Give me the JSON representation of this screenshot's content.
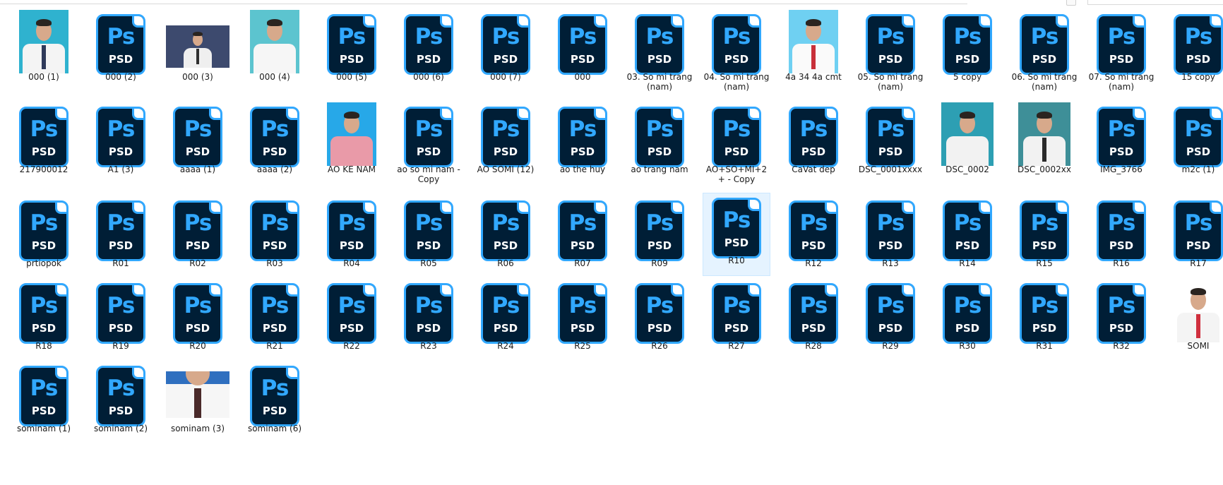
{
  "colors": {
    "ps_border": "#31a8ff",
    "ps_bg": "#001e36",
    "selection_bg": "#e5f3ff",
    "photo_blue": "#33b9d6"
  },
  "icon_text": {
    "ps": "Ps",
    "psd": "PSD"
  },
  "files": [
    {
      "name": "000 (1)",
      "type": "photo",
      "bg": "#2fb2cf",
      "shirt": "#f4f4f4",
      "tie": "#2f3a5a"
    },
    {
      "name": "000 (2)",
      "type": "psd"
    },
    {
      "name": "000 (3)",
      "type": "photo",
      "bg": "#3d4a6e",
      "shirt": "#efefef",
      "tie": "#303030"
    },
    {
      "name": "000 (4)",
      "type": "photo",
      "bg": "#5cc4cf",
      "shirt": "#f6f6f6",
      "tie": null
    },
    {
      "name": "000 (5)",
      "type": "psd"
    },
    {
      "name": "000 (6)",
      "type": "psd"
    },
    {
      "name": "000 (7)",
      "type": "psd"
    },
    {
      "name": "000",
      "type": "psd"
    },
    {
      "name": "03. So mi trang (nam)",
      "type": "psd"
    },
    {
      "name": "04. So mi trang (nam)",
      "type": "psd"
    },
    {
      "name": "4a 34 4a cmt",
      "type": "photo",
      "bg": "#6fd0f2",
      "shirt": "#fafafa",
      "tie": "#c8303a"
    },
    {
      "name": "05. So mi trang (nam)",
      "type": "psd"
    },
    {
      "name": "5 copy",
      "type": "psd"
    },
    {
      "name": "06. So mi trang (nam)",
      "type": "psd"
    },
    {
      "name": "07. So mi trang (nam)",
      "type": "psd"
    },
    {
      "name": "15 copy",
      "type": "psd"
    },
    {
      "name": "217900012",
      "type": "psd"
    },
    {
      "name": "A1 (3)",
      "type": "psd"
    },
    {
      "name": "aaaa (1)",
      "type": "psd"
    },
    {
      "name": "aaaa (2)",
      "type": "psd"
    },
    {
      "name": "AO KE NAM",
      "type": "photo",
      "bg": "#27a8e8",
      "shirt": "#e99aa8",
      "tie": null
    },
    {
      "name": "ao so mi nam - Copy",
      "type": "psd"
    },
    {
      "name": "AO SOMI (12)",
      "type": "psd"
    },
    {
      "name": "ao the huy",
      "type": "psd"
    },
    {
      "name": "ao trang nam",
      "type": "psd"
    },
    {
      "name": "AO+SO+MI+2+ - Copy",
      "type": "psd"
    },
    {
      "name": "CaVat dep",
      "type": "psd"
    },
    {
      "name": "DSC_0001xxxx",
      "type": "psd"
    },
    {
      "name": "DSC_0002",
      "type": "photo",
      "bg": "#2d9fb3",
      "shirt": "#f2f2f2",
      "tie": null
    },
    {
      "name": "DSC_0002xx",
      "type": "photo",
      "bg": "#3e8f98",
      "shirt": "#f2f2f2",
      "tie": "#2a2a2a"
    },
    {
      "name": "IMG_3766",
      "type": "psd"
    },
    {
      "name": "m2c (1)",
      "type": "psd"
    },
    {
      "name": "prtiopok",
      "type": "psd"
    },
    {
      "name": "R01",
      "type": "psd"
    },
    {
      "name": "R02",
      "type": "psd"
    },
    {
      "name": "R03",
      "type": "psd"
    },
    {
      "name": "R04",
      "type": "psd"
    },
    {
      "name": "R05",
      "type": "psd"
    },
    {
      "name": "R06",
      "type": "psd"
    },
    {
      "name": "R07",
      "type": "psd"
    },
    {
      "name": "R09",
      "type": "psd"
    },
    {
      "name": "R10",
      "type": "psd",
      "selected": true
    },
    {
      "name": "R12",
      "type": "psd"
    },
    {
      "name": "R13",
      "type": "psd"
    },
    {
      "name": "R14",
      "type": "psd"
    },
    {
      "name": "R15",
      "type": "psd"
    },
    {
      "name": "R16",
      "type": "psd"
    },
    {
      "name": "R17",
      "type": "psd"
    },
    {
      "name": "R18",
      "type": "psd"
    },
    {
      "name": "R19",
      "type": "psd"
    },
    {
      "name": "R20",
      "type": "psd"
    },
    {
      "name": "R21",
      "type": "psd"
    },
    {
      "name": "R22",
      "type": "psd"
    },
    {
      "name": "R23",
      "type": "psd"
    },
    {
      "name": "R24",
      "type": "psd"
    },
    {
      "name": "R25",
      "type": "psd"
    },
    {
      "name": "R26",
      "type": "psd"
    },
    {
      "name": "R27",
      "type": "psd"
    },
    {
      "name": "R28",
      "type": "psd"
    },
    {
      "name": "R29",
      "type": "psd"
    },
    {
      "name": "R30",
      "type": "psd"
    },
    {
      "name": "R31",
      "type": "psd"
    },
    {
      "name": "R32",
      "type": "psd"
    },
    {
      "name": "SOMI",
      "type": "photo",
      "bg": "#ffffff",
      "shirt": "#f4f4f4",
      "tie": "#d0303e"
    },
    {
      "name": "sominam (1)",
      "type": "psd"
    },
    {
      "name": "sominam (2)",
      "type": "psd"
    },
    {
      "name": "sominam (3)",
      "type": "photo",
      "bg": "#2f6fbf",
      "shirt": "#f6f6f6",
      "tie": "#4a2a2a"
    },
    {
      "name": "sominam (6)",
      "type": "psd"
    }
  ]
}
